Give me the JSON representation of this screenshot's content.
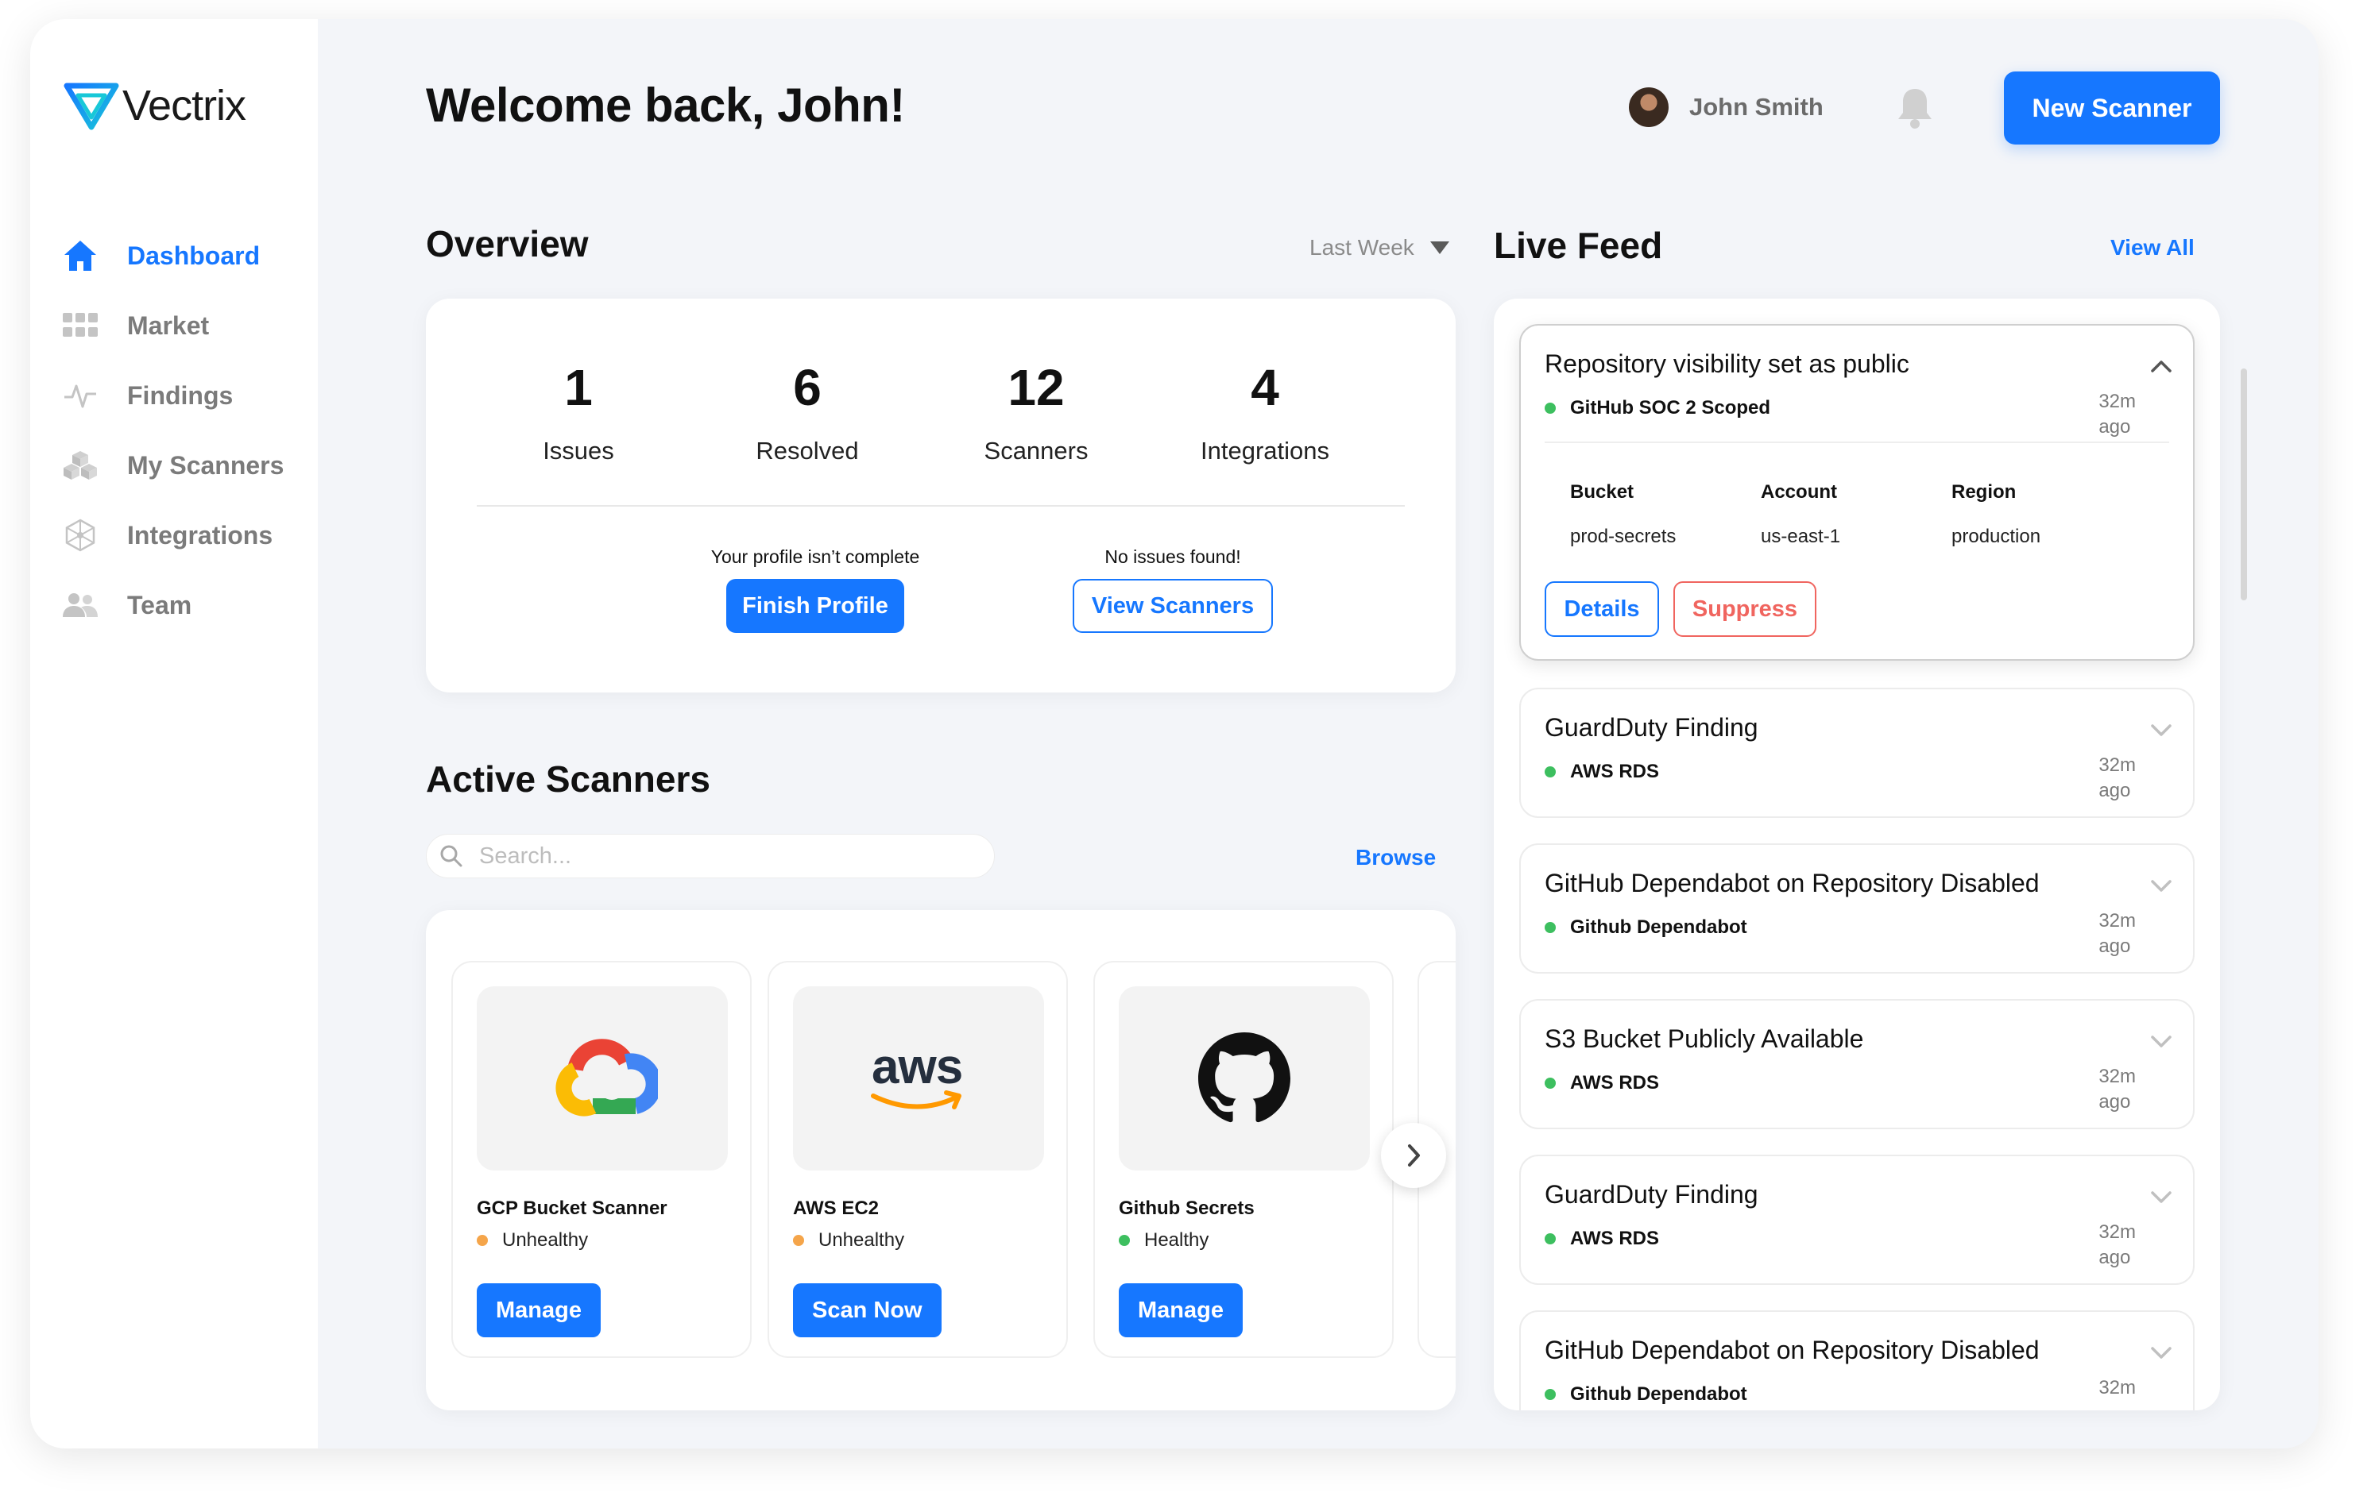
{
  "brand": {
    "name": "Vectrix",
    "accent": "#1677ff"
  },
  "sidebar": {
    "items": [
      {
        "label": "Dashboard",
        "icon": "home-icon",
        "active": true
      },
      {
        "label": "Market",
        "icon": "grid-icon",
        "active": false
      },
      {
        "label": "Findings",
        "icon": "pulse-icon",
        "active": false
      },
      {
        "label": "My Scanners",
        "icon": "cubes-icon",
        "active": false
      },
      {
        "label": "Integrations",
        "icon": "network-icon",
        "active": false
      },
      {
        "label": "Team",
        "icon": "team-icon",
        "active": false
      }
    ]
  },
  "header": {
    "welcome": "Welcome back, John!",
    "user_name": "John Smith",
    "new_scanner_label": "New Scanner"
  },
  "overview": {
    "title": "Overview",
    "period": "Last Week",
    "stats": [
      {
        "value": "1",
        "label": "Issues"
      },
      {
        "value": "6",
        "label": "Resolved"
      },
      {
        "value": "12",
        "label": "Scanners"
      },
      {
        "value": "4",
        "label": "Integrations"
      }
    ],
    "profile_text": "Your profile isn’t complete",
    "profile_button": "Finish Profile",
    "issues_text": "No issues found!",
    "issues_button": "View Scanners"
  },
  "active_scanners": {
    "title": "Active Scanners",
    "search_placeholder": "Search...",
    "browse_label": "Browse",
    "items": [
      {
        "name": "GCP Bucket Scanner",
        "status": "Unhealthy",
        "status_color": "#f5a54a",
        "action": "Manage",
        "logo": "gcp-cloud-icon"
      },
      {
        "name": "AWS EC2",
        "status": "Unhealthy",
        "status_color": "#f5a54a",
        "action": "Scan Now",
        "logo": "aws-logo-icon",
        "logo_text": "aws"
      },
      {
        "name": "Github Secrets",
        "status": "Healthy",
        "status_color": "#3dbf5f",
        "action": "Manage",
        "logo": "github-icon"
      }
    ]
  },
  "live_feed": {
    "title": "Live Feed",
    "view_all_label": "View All",
    "items": [
      {
        "title": "Repository visibility set as public",
        "source": "GitHub SOC 2 Scoped",
        "time_1": "32m",
        "time_2": "ago",
        "expanded": true,
        "details": [
          {
            "label": "Bucket",
            "value": "prod-secrets"
          },
          {
            "label": "Account",
            "value": "us-east-1"
          },
          {
            "label": "Region",
            "value": "production"
          }
        ],
        "details_button": "Details",
        "suppress_button": "Suppress"
      },
      {
        "title": "GuardDuty Finding",
        "source": "AWS RDS",
        "time_1": "32m",
        "time_2": "ago"
      },
      {
        "title": "GitHub Dependabot on Repository Disabled",
        "source": "Github Dependabot",
        "time_1": "32m",
        "time_2": "ago"
      },
      {
        "title": "S3 Bucket Publicly Available",
        "source": "AWS RDS",
        "time_1": "32m",
        "time_2": "ago"
      },
      {
        "title": "GuardDuty Finding",
        "source": "AWS RDS",
        "time_1": "32m",
        "time_2": "ago"
      },
      {
        "title": "GitHub Dependabot on Repository Disabled",
        "source": "Github Dependabot",
        "time_1": "32m",
        "time_2": ""
      }
    ]
  }
}
